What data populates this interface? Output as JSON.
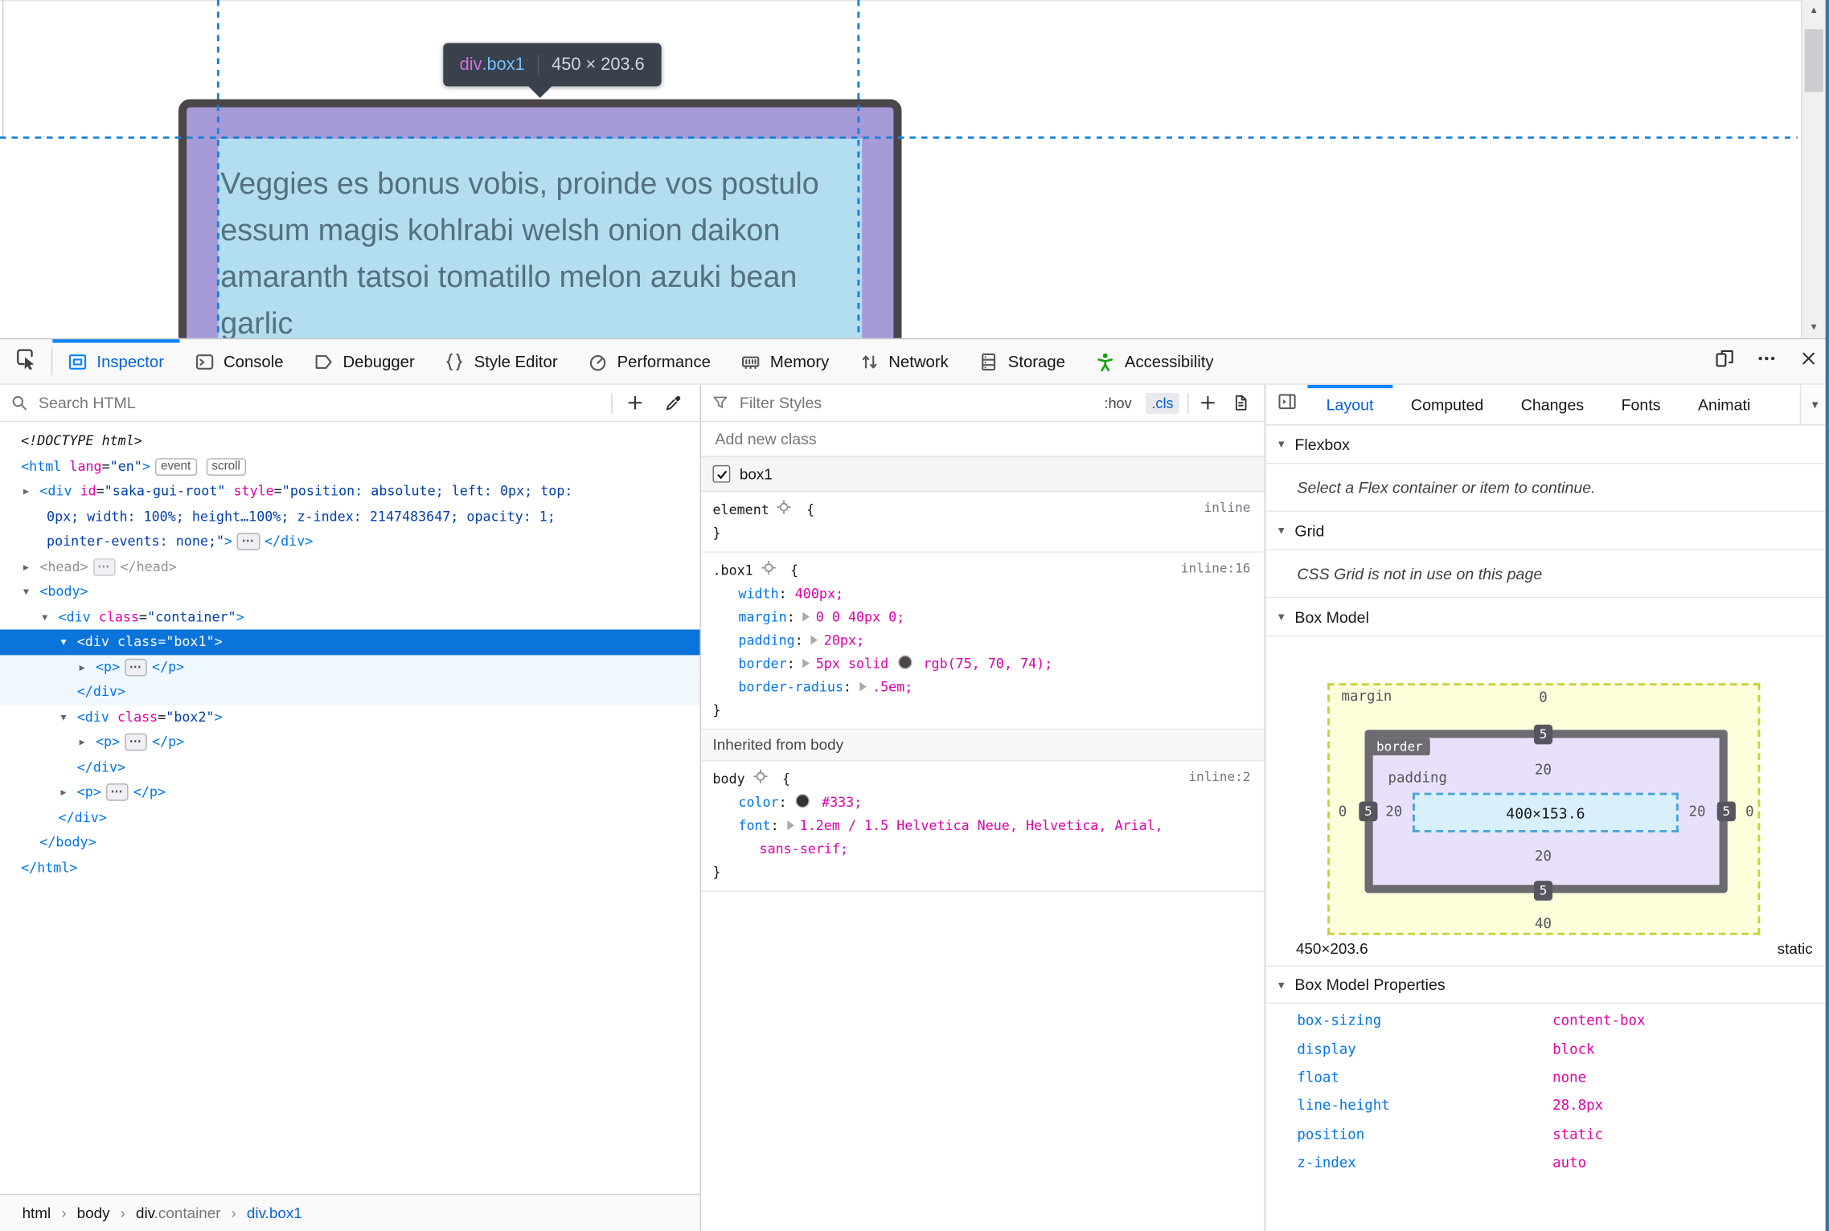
{
  "colors": {
    "accent": "#0a84ff",
    "selection_blue": "#0b74da",
    "tag_blue": "#0074e9",
    "attr_pink": "#dd00a9",
    "value_navy": "#003eaa",
    "highlight_content": "#b2def0",
    "highlight_padding": "#a69ad8",
    "box_border": "#4b464a",
    "accessibility_green": "#16a20c"
  },
  "page_view": {
    "infobar": {
      "tag": "div",
      "cls": ".box1",
      "dims": "450 × 203.6"
    },
    "lines": [
      "Veggies es bonus vobis, proinde vos postulo",
      "essum magis kohlrabi welsh onion daikon",
      "amaranth tatsoi tomatillo melon azuki bean",
      "garlic"
    ]
  },
  "toolbar": {
    "tabs": [
      {
        "id": "inspector",
        "label": "Inspector",
        "active": true
      },
      {
        "id": "console",
        "label": "Console"
      },
      {
        "id": "debugger",
        "label": "Debugger"
      },
      {
        "id": "style-editor",
        "label": "Style Editor"
      },
      {
        "id": "performance",
        "label": "Performance"
      },
      {
        "id": "memory",
        "label": "Memory"
      },
      {
        "id": "network",
        "label": "Network"
      },
      {
        "id": "storage",
        "label": "Storage"
      },
      {
        "id": "accessibility",
        "label": "Accessibility"
      }
    ]
  },
  "markup_panel": {
    "search_placeholder": "Search HTML",
    "lines": [
      {
        "ind": 0,
        "toks": [
          [
            "d",
            "<!DOCTYPE html>"
          ]
        ]
      },
      {
        "ind": 0,
        "toks": [
          [
            "t",
            "<html"
          ],
          [
            "a",
            " lang"
          ],
          [
            "p",
            "="
          ],
          [
            "v",
            "\"en\""
          ],
          [
            "t",
            ">"
          ]
        ],
        "badges": [
          "event",
          "scroll"
        ]
      },
      {
        "ind": 1,
        "arr": "r",
        "toks": [
          [
            "t",
            "<div"
          ],
          [
            "a",
            " id"
          ],
          [
            "p",
            "="
          ],
          [
            "v",
            "\"saka-gui-root\""
          ],
          [
            "a",
            " style"
          ],
          [
            "p",
            "="
          ],
          [
            "v",
            "\"position: absolute; left: 0px; top:"
          ]
        ]
      },
      {
        "ind": 1,
        "cont": true,
        "toks": [
          [
            "v",
            "0px; width: 100%; height…100%; z-index: 2147483647; opacity: 1;"
          ]
        ]
      },
      {
        "ind": 1,
        "cont": true,
        "toks": [
          [
            "v",
            "pointer-events: none;\""
          ],
          [
            "t",
            ">"
          ],
          [
            "dots",
            ""
          ],
          [
            "t",
            "</div>"
          ]
        ]
      },
      {
        "ind": 1,
        "arr": "r",
        "dim": true,
        "toks": [
          [
            "t",
            "<head>"
          ],
          [
            "dots",
            ""
          ],
          [
            "t",
            "</head>"
          ]
        ]
      },
      {
        "ind": 1,
        "arr": "d",
        "toks": [
          [
            "t",
            "<body>"
          ]
        ]
      },
      {
        "ind": 2,
        "arr": "d",
        "toks": [
          [
            "t",
            "<div"
          ],
          [
            "a",
            " class"
          ],
          [
            "p",
            "="
          ],
          [
            "v",
            "\"container\""
          ],
          [
            "t",
            ">"
          ]
        ]
      },
      {
        "ind": 3,
        "arr": "d",
        "sel": true,
        "toks": [
          [
            "t",
            "<div"
          ],
          [
            "a",
            " class"
          ],
          [
            "p",
            "="
          ],
          [
            "v",
            "\"box1\""
          ],
          [
            "t",
            ">"
          ]
        ]
      },
      {
        "ind": 4,
        "arr": "r",
        "tint": true,
        "toks": [
          [
            "t",
            "<p>"
          ],
          [
            "dots",
            ""
          ],
          [
            "t",
            "</p>"
          ]
        ]
      },
      {
        "ind": 3,
        "tint": true,
        "toks": [
          [
            "t",
            "</div>"
          ]
        ]
      },
      {
        "ind": 3,
        "arr": "d",
        "toks": [
          [
            "t",
            "<div"
          ],
          [
            "a",
            " class"
          ],
          [
            "p",
            "="
          ],
          [
            "v",
            "\"box2\""
          ],
          [
            "t",
            ">"
          ]
        ]
      },
      {
        "ind": 4,
        "arr": "r",
        "toks": [
          [
            "t",
            "<p>"
          ],
          [
            "dots",
            ""
          ],
          [
            "t",
            "</p>"
          ]
        ]
      },
      {
        "ind": 3,
        "toks": [
          [
            "t",
            "</div>"
          ]
        ]
      },
      {
        "ind": 3,
        "arr": "r",
        "toks": [
          [
            "t",
            "<p>"
          ],
          [
            "dots",
            ""
          ],
          [
            "t",
            "</p>"
          ]
        ]
      },
      {
        "ind": 2,
        "toks": [
          [
            "t",
            "</div>"
          ]
        ]
      },
      {
        "ind": 1,
        "toks": [
          [
            "t",
            "</body>"
          ]
        ]
      },
      {
        "ind": 0,
        "toks": [
          [
            "t",
            "</html>"
          ]
        ]
      }
    ]
  },
  "rules_panel": {
    "filter_placeholder": "Filter Styles",
    "pseudo_button": ":hov",
    "class_button": ".cls",
    "add_class_placeholder": "Add new class",
    "class_toggle": {
      "checked": true,
      "label": "box1"
    },
    "sections": [
      {
        "type": "rule",
        "selector": "element",
        "source": "inline",
        "decls": []
      },
      {
        "type": "rule",
        "selector": ".box1",
        "source": "inline:16",
        "decls": [
          {
            "name": "width",
            "parts": [
              {
                "t": "400px;"
              }
            ]
          },
          {
            "name": "margin",
            "expand": true,
            "parts": [
              {
                "t": "0 0 40px 0;"
              }
            ]
          },
          {
            "name": "padding",
            "expand": true,
            "parts": [
              {
                "t": "20px;"
              }
            ]
          },
          {
            "name": "border",
            "expand": true,
            "parts": [
              {
                "t": "5px solid "
              },
              {
                "sw": "#4b464a"
              },
              {
                "t": " rgb(75, 70, 74);"
              }
            ]
          },
          {
            "name": "border-radius",
            "expand": true,
            "parts": [
              {
                "t": ".5em;"
              }
            ]
          }
        ]
      },
      {
        "type": "header",
        "text": "Inherited from body"
      },
      {
        "type": "rule",
        "selector": "body",
        "source": "inline:2",
        "decls": [
          {
            "name": "color",
            "parts": [
              {
                "sw": "#333333"
              },
              {
                "t": " #333;"
              }
            ]
          },
          {
            "name": "font",
            "expand": true,
            "parts": [
              {
                "t": "1.2em / 1.5 Helvetica Neue, Helvetica, Arial,"
              }
            ],
            "wrap": "sans-serif;"
          }
        ]
      }
    ]
  },
  "sidebar": {
    "tabs": [
      {
        "id": "layout",
        "label": "Layout",
        "active": true
      },
      {
        "id": "computed",
        "label": "Computed"
      },
      {
        "id": "changes",
        "label": "Changes"
      },
      {
        "id": "fonts",
        "label": "Fonts"
      },
      {
        "id": "animations",
        "label": "Animati"
      }
    ],
    "flexbox": {
      "title": "Flexbox",
      "message": "Select a Flex container or item to continue."
    },
    "grid": {
      "title": "Grid",
      "message": "CSS Grid is not in use on this page"
    },
    "box_model": {
      "title": "Box Model",
      "margin_label": "margin",
      "border_label": "border",
      "padding_label": "padding",
      "content_dims": "400×153.6",
      "margin_top": "0",
      "margin_left": "0",
      "margin_right": "0",
      "margin_bottom": "40",
      "border_top": "5",
      "border_left": "5",
      "border_right": "5",
      "border_bottom": "5",
      "padding_top": "20",
      "padding_left": "20",
      "padding_right": "20",
      "padding_bottom": "20",
      "element_dims": "450×203.6",
      "position": "static"
    },
    "box_model_properties": {
      "title": "Box Model Properties",
      "rows": [
        [
          "box-sizing",
          "content-box"
        ],
        [
          "display",
          "block"
        ],
        [
          "float",
          "none"
        ],
        [
          "line-height",
          "28.8px"
        ],
        [
          "position",
          "static"
        ],
        [
          "z-index",
          "auto"
        ]
      ]
    }
  },
  "breadcrumb": {
    "separator": "›",
    "items": [
      {
        "label": "html"
      },
      {
        "label": "body"
      },
      {
        "label": "div",
        "suffix": ".container"
      },
      {
        "label": "div.box1",
        "selected": true
      }
    ]
  }
}
